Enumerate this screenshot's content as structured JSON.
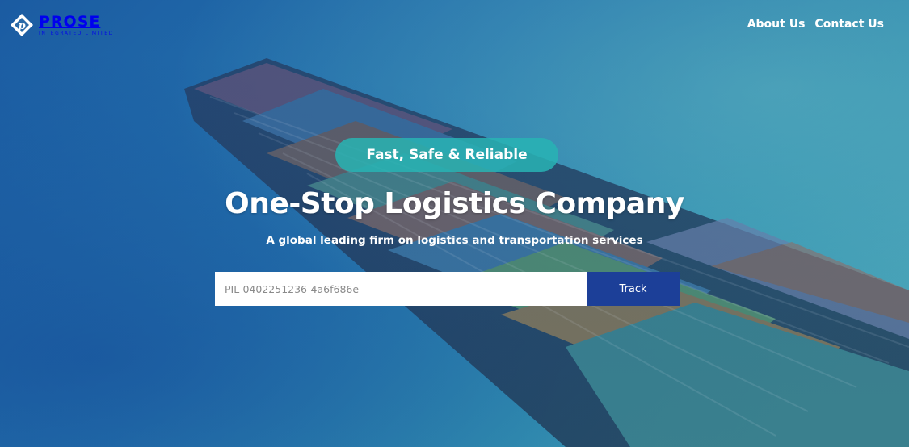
{
  "brand": {
    "name": "PROSE",
    "subtitle": "INTEGRATED LIMITED",
    "logo_icon": "diamond-p-logo-icon"
  },
  "nav": {
    "items": [
      {
        "label": "About Us"
      },
      {
        "label": "Contact Us"
      }
    ]
  },
  "hero": {
    "tagline": "Fast, Safe & Reliable",
    "headline": "One-Stop Logistics Company",
    "subheadline": "A global leading firm on logistics and transportation services"
  },
  "tracking": {
    "placeholder": "PIL-0402251236-4a6f686e",
    "value": "",
    "button_label": "Track"
  },
  "colors": {
    "accent_pill": "#2bb4b4",
    "button": "#1c3f98",
    "ocean": "#1d6aa8"
  }
}
